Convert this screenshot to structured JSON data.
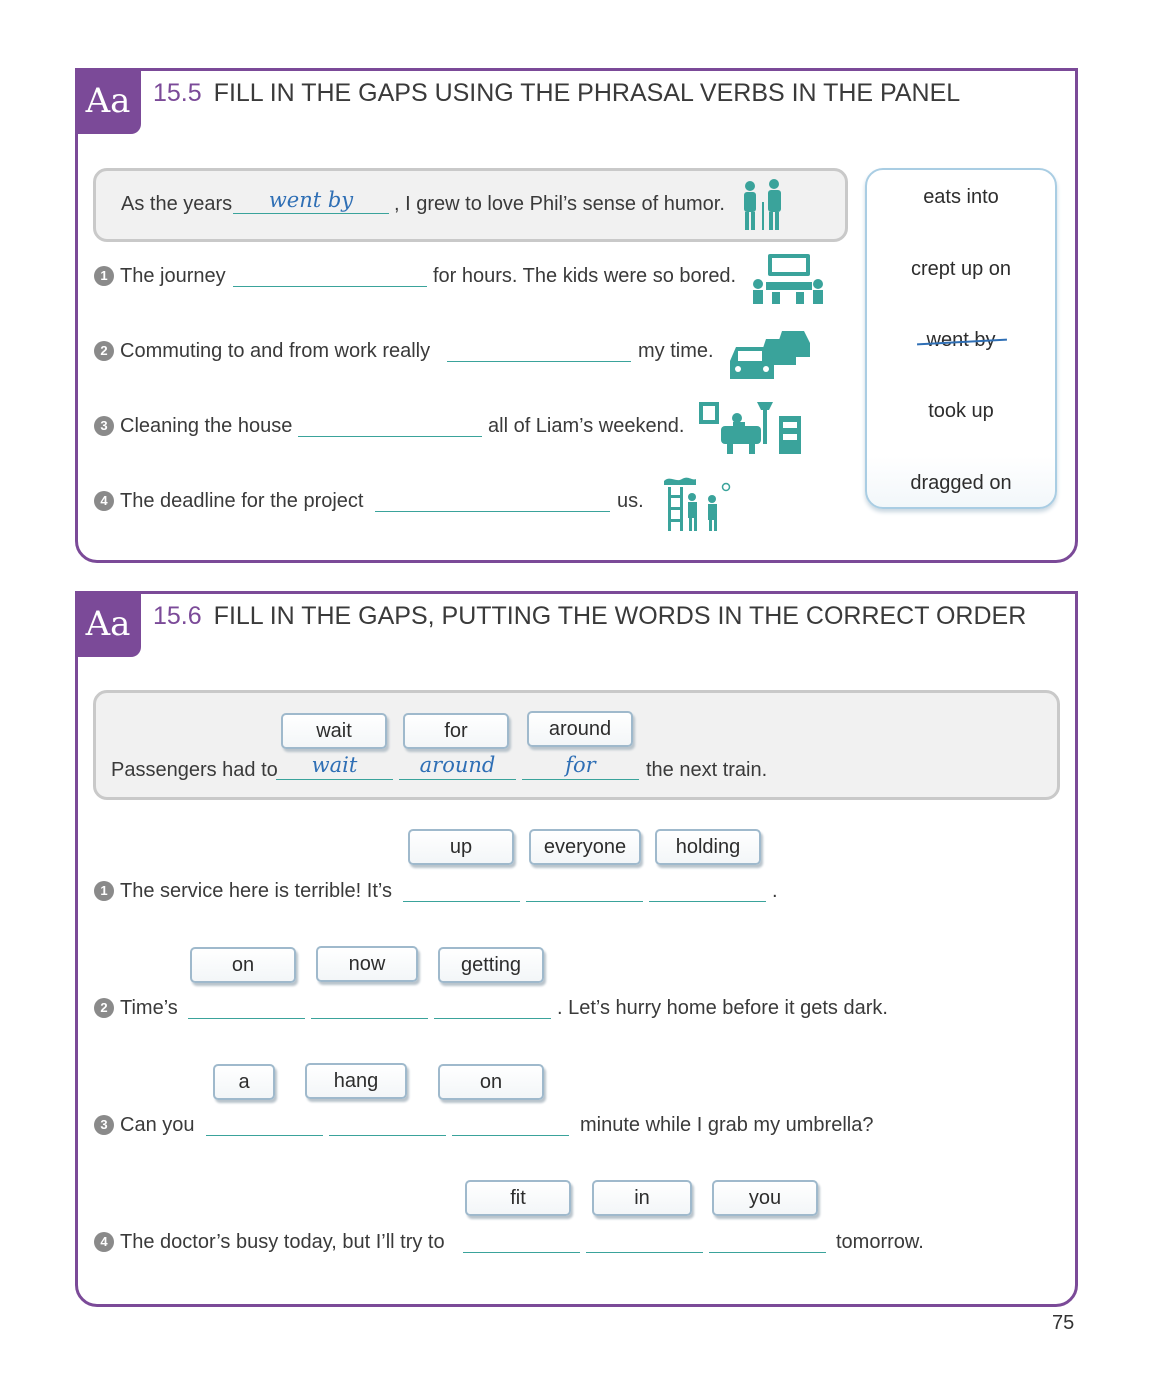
{
  "ex155": {
    "icon_label": "Aa",
    "number": "15.5",
    "title": "FILL IN THE GAPS USING THE PHRASAL VERBS IN THE PANEL",
    "example": {
      "before": "As the years",
      "answer": "went by",
      "after": ", I grew to love Phil’s sense of humor."
    },
    "items": [
      {
        "num": "1",
        "before": "The journey",
        "after": "for hours. The kids were so bored."
      },
      {
        "num": "2",
        "before": "Commuting to and from work really",
        "after": "my time."
      },
      {
        "num": "3",
        "before": "Cleaning the house",
        "after": "all of Liam’s weekend."
      },
      {
        "num": "4",
        "before": "The deadline for the project",
        "after": "us."
      }
    ],
    "panel": [
      "eats into",
      "crept up on",
      "went by",
      "took up",
      "dragged on"
    ]
  },
  "ex156": {
    "icon_label": "Aa",
    "number": "15.6",
    "title": "FILL IN THE GAPS, PUTTING THE WORDS IN THE CORRECT ORDER",
    "example": {
      "tiles": [
        "wait",
        "for",
        "around"
      ],
      "before": "Passengers had to",
      "answers": [
        "wait",
        "around",
        "for"
      ],
      "after": "the next train."
    },
    "items": [
      {
        "num": "1",
        "tiles": [
          "up",
          "everyone",
          "holding"
        ],
        "before": "The service here is terrible! It’s",
        "after": "."
      },
      {
        "num": "2",
        "tiles": [
          "on",
          "now",
          "getting"
        ],
        "before": "Time’s",
        "after": ". Let’s hurry home before it gets dark."
      },
      {
        "num": "3",
        "tiles": [
          "a",
          "hang",
          "on"
        ],
        "before": "Can you",
        "after": "minute while I grab my umbrella?"
      },
      {
        "num": "4",
        "tiles": [
          "fit",
          "in",
          "you"
        ],
        "before": "The doctor’s busy today, but I’ll try to",
        "after": "tomorrow."
      }
    ]
  },
  "page_number": "75",
  "colors": {
    "accent": "#7b4a98",
    "answer": "#2f6fb5",
    "illustration": "#3aa39b"
  }
}
